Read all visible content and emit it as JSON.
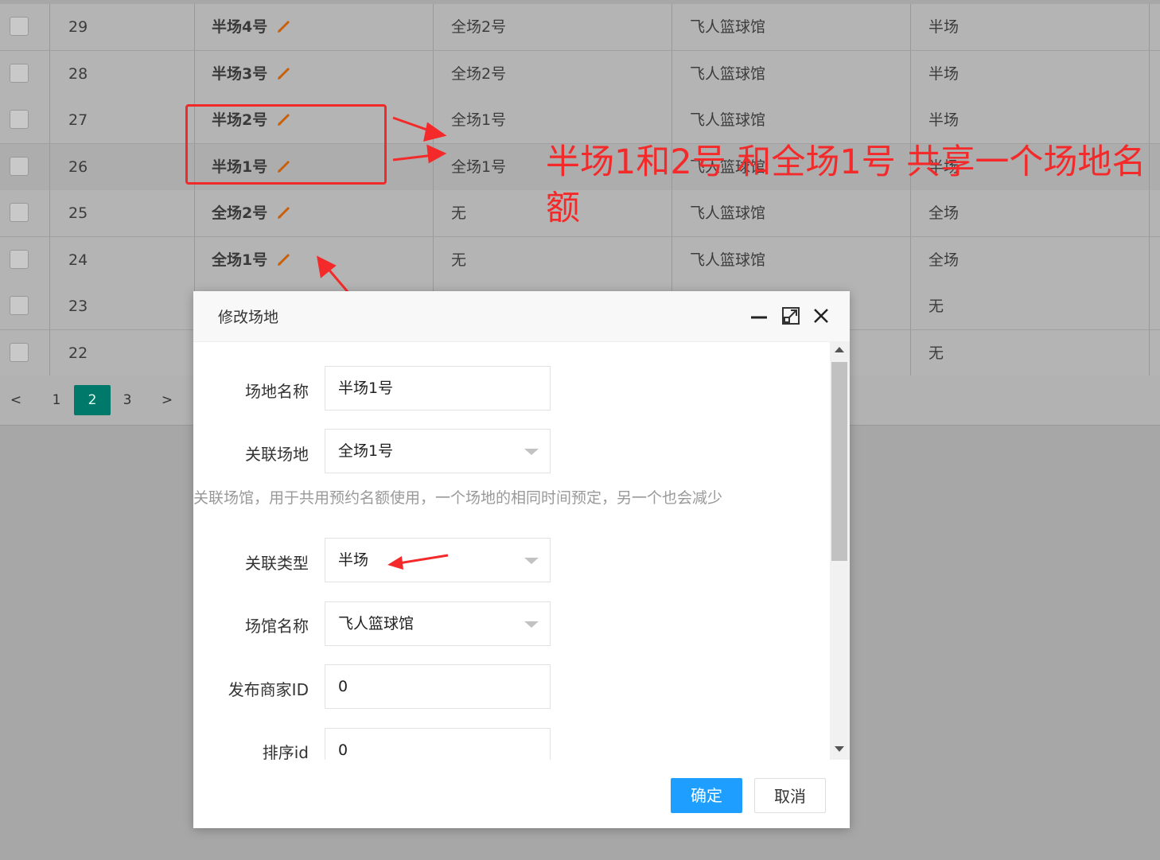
{
  "table": {
    "rows": [
      {
        "id": "29",
        "name": "半场4号",
        "related": "全场2号",
        "venue": "飞人篮球馆",
        "type": "半场"
      },
      {
        "id": "28",
        "name": "半场3号",
        "related": "全场2号",
        "venue": "飞人篮球馆",
        "type": "半场"
      },
      {
        "id": "27",
        "name": "半场2号",
        "related": "全场1号",
        "venue": "飞人篮球馆",
        "type": "半场"
      },
      {
        "id": "26",
        "name": "半场1号",
        "related": "全场1号",
        "venue": "飞人篮球馆",
        "type": "半场"
      },
      {
        "id": "25",
        "name": "全场2号",
        "related": "无",
        "venue": "飞人篮球馆",
        "type": "全场"
      },
      {
        "id": "24",
        "name": "全场1号",
        "related": "无",
        "venue": "飞人篮球馆",
        "type": "全场"
      },
      {
        "id": "23",
        "name": "",
        "related": "",
        "venue": "",
        "type": "无"
      },
      {
        "id": "22",
        "name": "",
        "related": "",
        "venue": "",
        "type": "无"
      }
    ]
  },
  "pager": {
    "prev": "<",
    "pages": [
      "1",
      "2",
      "3"
    ],
    "current": "2",
    "next": ">"
  },
  "annotation": {
    "text": "半场1和2号 和全场1号 共享一个场地名额"
  },
  "dialog": {
    "title": "修改场地",
    "fields": {
      "name_label": "场地名称",
      "name_value": "半场1号",
      "related_label": "关联场地",
      "related_value": "全场1号",
      "hint": "关联场馆，用于共用预约名额使用，一个场地的相同时间预定，另一个也会减少",
      "type_label": "关联类型",
      "type_value": "半场",
      "venue_label": "场馆名称",
      "venue_value": "飞人篮球馆",
      "merchant_label": "发布商家ID",
      "merchant_value": "0",
      "sort_label": "排序id",
      "sort_value": "0"
    },
    "ok_label": "确定",
    "cancel_label": "取消"
  },
  "colors": {
    "annotation_red": "#f42a2a",
    "primary_blue": "#1e9fff",
    "pager_active": "#00796b"
  }
}
